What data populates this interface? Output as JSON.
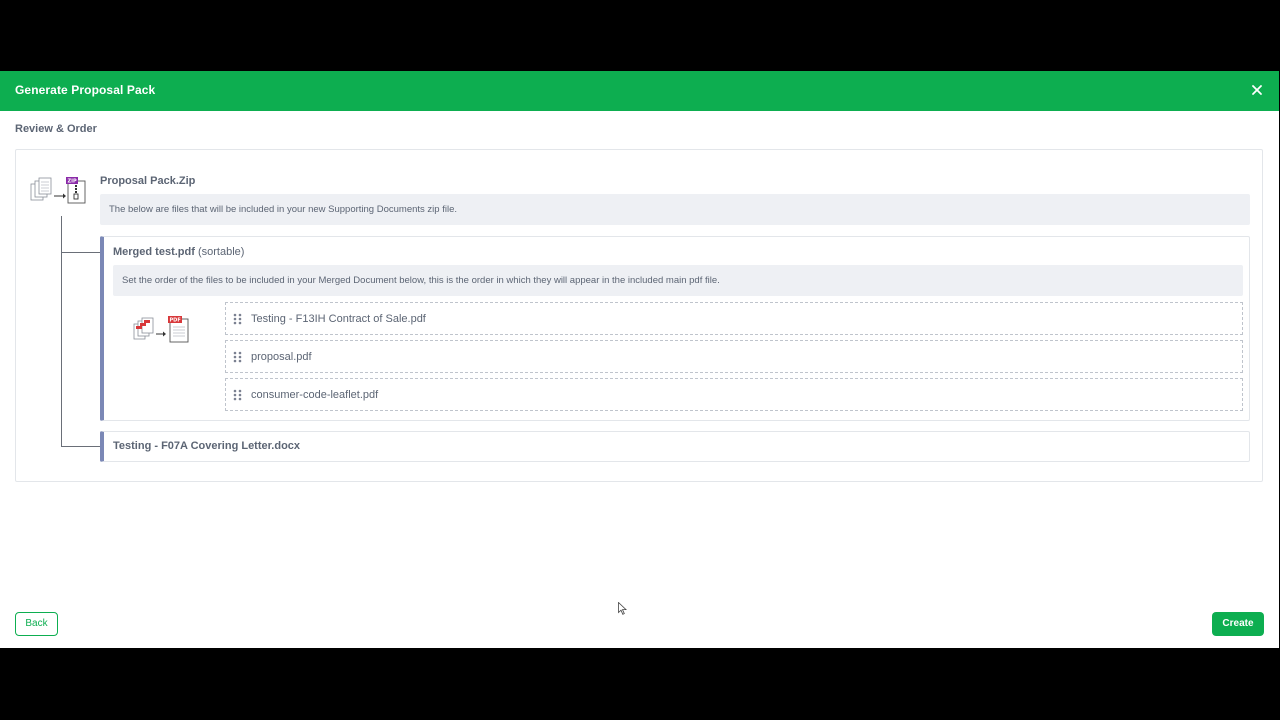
{
  "modal": {
    "title": "Generate Proposal Pack",
    "close_icon": "close-icon"
  },
  "section": {
    "title": "Review & Order"
  },
  "zip": {
    "icon": "zip-files-icon",
    "name": "Proposal Pack.Zip",
    "info": "The below are files that will be included in your new Supporting Documents zip file."
  },
  "merged": {
    "name": "Merged test.pdf",
    "suffix": " (sortable)",
    "info": "Set the order of the files to be included in your Merged Document below, this is the order in which they will appear in the included main pdf file.",
    "icon": "pdf-merge-icon",
    "items": [
      {
        "label": "Testing - F13IH Contract of Sale.pdf",
        "icon": "drag-handle-icon"
      },
      {
        "label": "proposal.pdf",
        "icon": "drag-handle-icon"
      },
      {
        "label": "consumer-code-leaflet.pdf",
        "icon": "drag-handle-icon"
      }
    ]
  },
  "docx": {
    "name": "Testing - F07A Covering Letter.docx"
  },
  "footer": {
    "back_label": "Back",
    "create_label": "Create"
  },
  "colors": {
    "brand": "#0dae50",
    "accent_border": "#7b88b6",
    "info_bg": "#eef0f4",
    "text": "#5c6574"
  }
}
